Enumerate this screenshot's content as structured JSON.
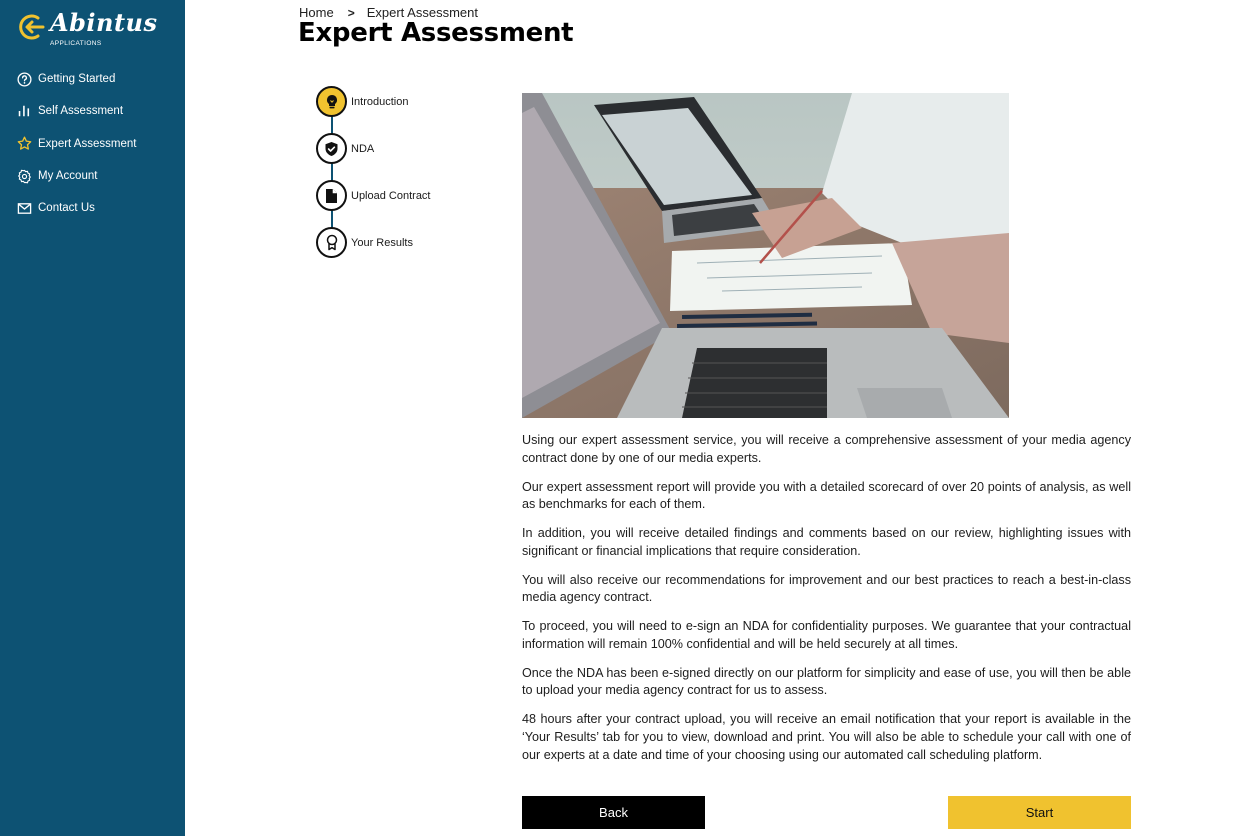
{
  "brand": {
    "name": "Abintus",
    "subtitle": "APPLICATIONS",
    "colors": {
      "sidebar": "#0d5273",
      "accent": "#f0c22f"
    }
  },
  "sidebar": {
    "items": [
      {
        "label": "Getting Started",
        "icon": "question-circle-icon",
        "active": false
      },
      {
        "label": "Self Assessment",
        "icon": "bar-chart-icon",
        "active": false
      },
      {
        "label": "Expert Assessment",
        "icon": "star-icon",
        "active": true
      },
      {
        "label": "My Account",
        "icon": "gear-icon",
        "active": false
      },
      {
        "label": "Contact Us",
        "icon": "mail-icon",
        "active": false
      }
    ]
  },
  "breadcrumb": {
    "home": "Home",
    "separator": ">",
    "current": "Expert Assessment"
  },
  "page": {
    "title": "Expert Assessment"
  },
  "steps": [
    {
      "label": "Introduction",
      "icon": "lightbulb-icon",
      "active": true
    },
    {
      "label": "NDA",
      "icon": "shield-check-icon",
      "active": false
    },
    {
      "label": "Upload Contract",
      "icon": "document-icon",
      "active": false
    },
    {
      "label": "Your Results",
      "icon": "award-ribbon-icon",
      "active": false
    }
  ],
  "hero_image": {
    "description": "People working at a desk with laptops and reviewing documents"
  },
  "content": {
    "paragraphs": [
      "Using our expert assessment service, you will receive a comprehensive assessment of your media agency contract done by one of our media experts.",
      "Our expert assessment report will provide you with a detailed scorecard of over 20 points of analysis, as well as benchmarks for each of them.",
      "In addition, you will receive detailed findings and comments based on our review, highlighting issues with significant or financial implications that require consideration.",
      "You will also receive our recommendations for improvement and our best practices to reach a best-in-class media agency contract.",
      "To proceed, you will need to e-sign an NDA for confidentiality purposes. We guarantee that your contractual information will remain 100% confidential and will be held securely at all times.",
      "Once the NDA has been e-signed directly on our platform for simplicity and ease of use, you will then be able to upload your media agency contract for us to assess.",
      "48 hours after your contract upload, you will receive an email notification that your report is available in the ‘Your Results’ tab for you to view, download and print. You will also be able to schedule your call with one of our experts at a date and time of your choosing using our automated call scheduling platform."
    ]
  },
  "actions": {
    "back_label": "Back",
    "start_label": "Start"
  }
}
